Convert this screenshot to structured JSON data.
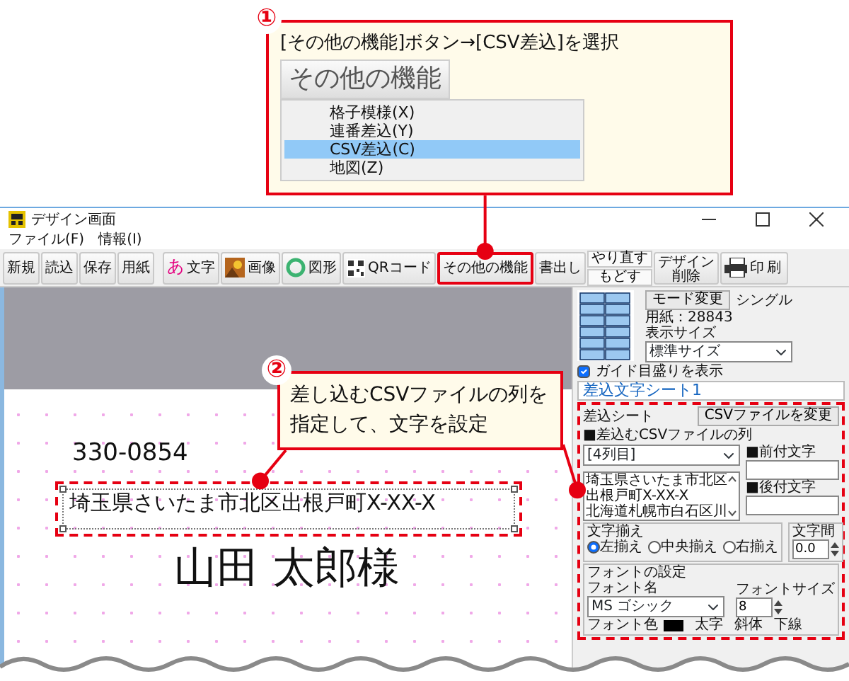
{
  "callouts": [
    {
      "number": "①",
      "text": "[その他の機能]ボタン→[CSV差込]を選択",
      "button_label": "その他の機能",
      "menu": [
        {
          "label": "格子模様(X)",
          "selected": false
        },
        {
          "label": "連番差込(Y)",
          "selected": false
        },
        {
          "label": "CSV差込(C)",
          "selected": true
        },
        {
          "label": "地図(Z)",
          "selected": false
        }
      ]
    },
    {
      "number": "②",
      "lines": [
        "差し込むCSVファイルの列を",
        "指定して、文字を設定"
      ]
    }
  ],
  "window": {
    "title": "デザイン画面",
    "menu": [
      "ファイル(F)",
      "情報(I)"
    ]
  },
  "toolbar": [
    {
      "kind": "plain",
      "label": "新規",
      "highlighted": false
    },
    {
      "kind": "plain",
      "label": "読込",
      "highlighted": false
    },
    {
      "kind": "plain",
      "label": "保存",
      "highlighted": false
    },
    {
      "kind": "plain",
      "label": "用紙",
      "highlighted": false
    },
    {
      "kind": "glyph",
      "glyph": "あ",
      "label": "文字",
      "highlighted": false
    },
    {
      "kind": "image",
      "label": "画像",
      "highlighted": false
    },
    {
      "kind": "shape",
      "label": "図形",
      "highlighted": false
    },
    {
      "kind": "qr",
      "label": "QRコード",
      "highlighted": false
    },
    {
      "kind": "plain",
      "label": "その他の機能",
      "highlighted": true
    },
    {
      "kind": "plain",
      "label": "書出し",
      "highlighted": false
    },
    {
      "kind": "pair",
      "top": "やり直す",
      "bottom": "もどす",
      "highlighted": false
    },
    {
      "kind": "caption",
      "caption": "デザイン",
      "label": "削除",
      "highlighted": false
    },
    {
      "kind": "print",
      "label": "印刷",
      "highlighted": false
    }
  ],
  "canvas": {
    "postal_code": "330-0854",
    "address": "埼玉県さいたま市北区出根戸町X-XX-X",
    "name": "山田 太郎様"
  },
  "panel": {
    "mode_button": "モード変更",
    "mode": "シングル",
    "paper": "用紙：28843",
    "size_label": "表示サイズ",
    "size_value": "標準サイズ",
    "guide": {
      "label": "ガイド目盛りを表示",
      "checked": true
    },
    "sheet_tab": "差込文字シート1",
    "merge": {
      "title": "差込シート",
      "change_button": "CSVファイルを変更",
      "column_label": "■差込むCSVファイルの列",
      "column_value": "[4列目]",
      "preview_lines": [
        "埼玉県さいたま市北区",
        "出根戸町X-XX-X",
        "北海道札幌市白石区川"
      ],
      "prefix_label": "■前付文字",
      "suffix_label": "■後付文字",
      "align": {
        "title": "文字揃え",
        "options": [
          {
            "label": "左揃え",
            "selected": true
          },
          {
            "label": "中央揃え",
            "selected": false
          },
          {
            "label": "右揃え",
            "selected": false
          }
        ]
      },
      "spacing": {
        "label": "文字間",
        "value": "0.0"
      },
      "font": {
        "title": "フォントの設定",
        "name_label": "フォント名",
        "name_value": "MS ゴシック",
        "size_label": "フォントサイズ",
        "size_value": "8",
        "color_label": "フォント色",
        "color": "#000000",
        "styles": [
          "太字",
          "斜体",
          "下線"
        ]
      }
    }
  }
}
